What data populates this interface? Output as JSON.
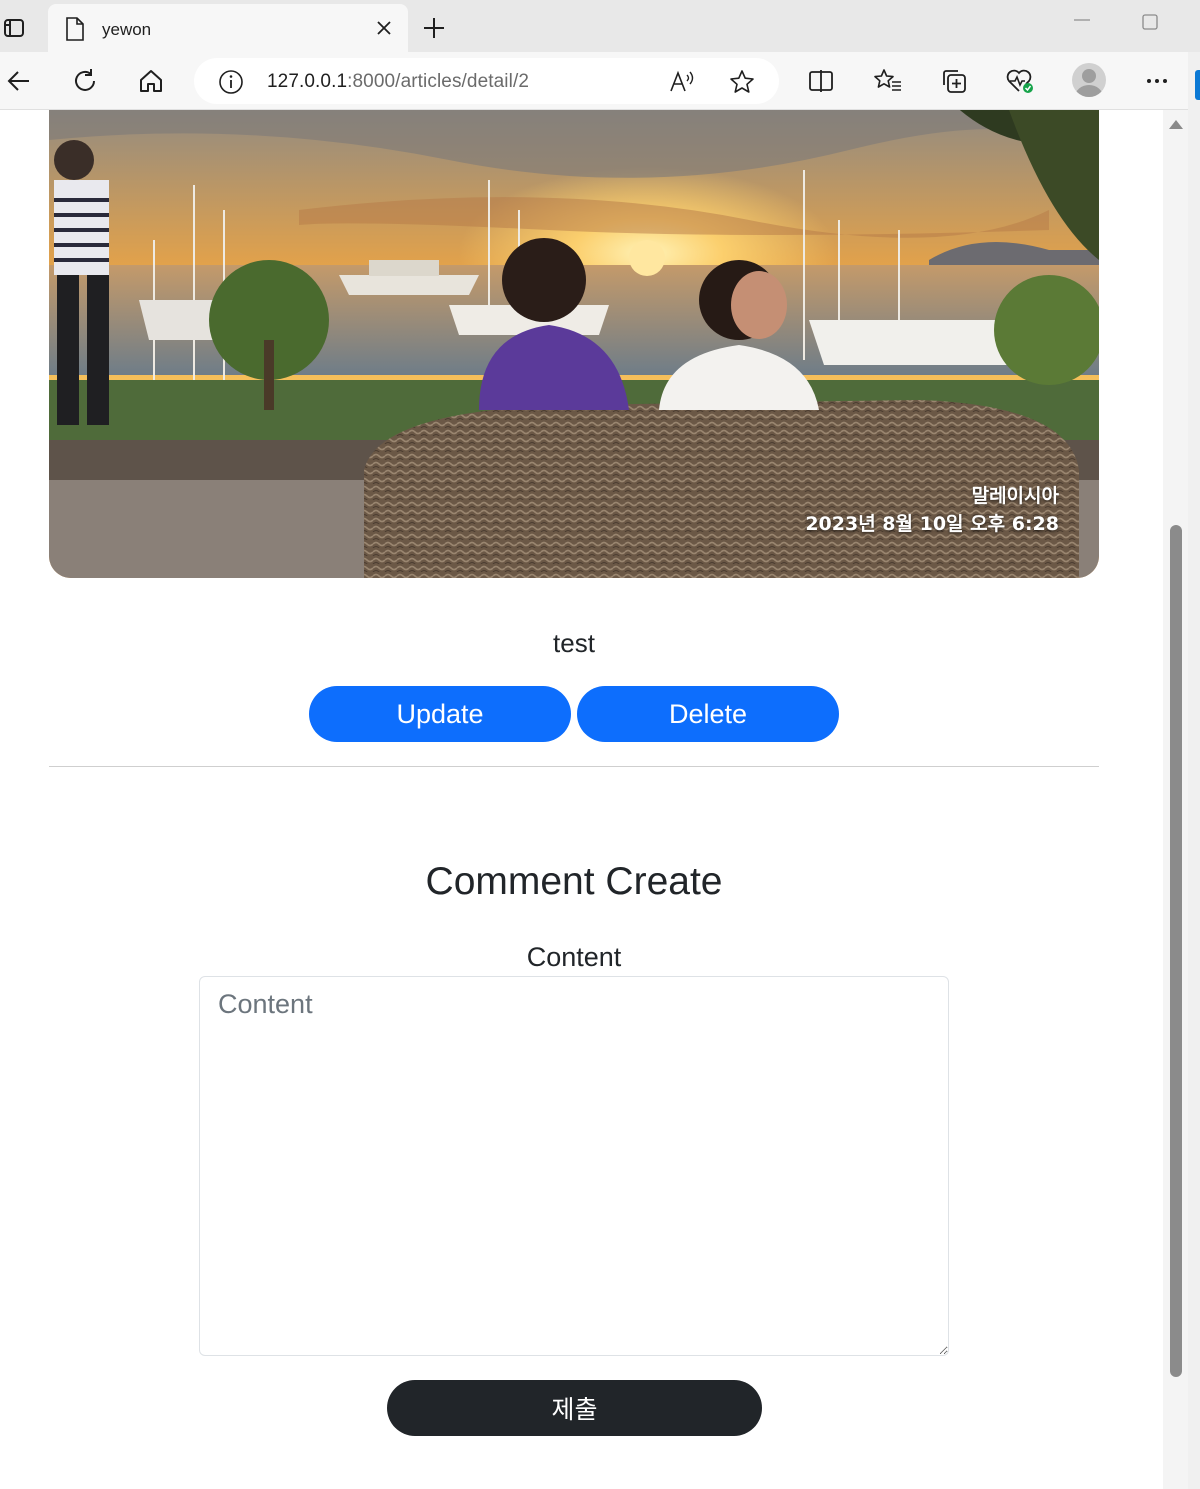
{
  "browser": {
    "tab_title": "yewon",
    "url_host": "127.0.0.1",
    "url_path": ":8000/articles/detail/2"
  },
  "hero_image": {
    "caption_location": "말레이시아",
    "caption_datetime": "2023년 8월 10일 오후 6:28"
  },
  "article": {
    "content": "test",
    "update_label": "Update",
    "delete_label": "Delete"
  },
  "comment_form": {
    "title": "Comment Create",
    "content_label": "Content",
    "content_placeholder": "Content",
    "submit_label": "제출"
  },
  "colors": {
    "primary": "#0d6efd",
    "dark": "#212529",
    "edge_accent": "#0a78d4"
  }
}
